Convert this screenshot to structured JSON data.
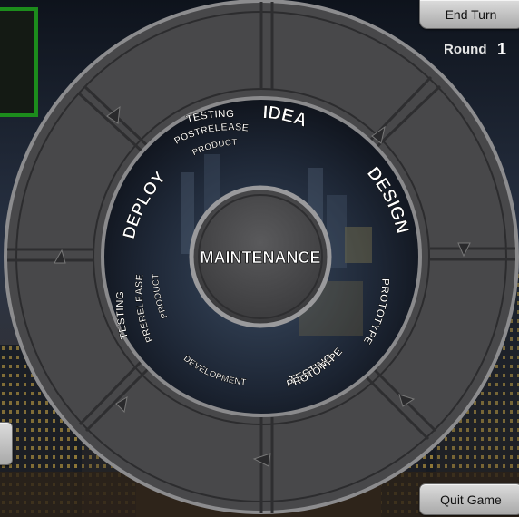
{
  "controls": {
    "end_turn_label": "End Turn",
    "quit_game_label": "Quit Game"
  },
  "round": {
    "label": "Round",
    "value": "1"
  },
  "wheel": {
    "center_label": "MAINTENANCE",
    "phases": {
      "idea": "IDEA",
      "design": "DESIGN",
      "prototype": "PROTOTYPE",
      "testing_prototype": "TESTING",
      "testing_prototype_sub": "PROTOTYPE",
      "development": "DEVELOPMENT",
      "testing_prerelease": "TESTING",
      "testing_prerelease_sub1": "PRERELEASE",
      "testing_prerelease_sub2": "PRODUCT",
      "deploy": "DEPLOY",
      "testing_postrelease": "TESTING",
      "testing_postrelease_sub1": "POSTRELEASE",
      "testing_postrelease_sub2": "PRODUCT"
    }
  },
  "colors": {
    "player_border": "#1c8c1c",
    "ring_fill": "#4a4a4c",
    "button_face": "#c8c8c8"
  }
}
